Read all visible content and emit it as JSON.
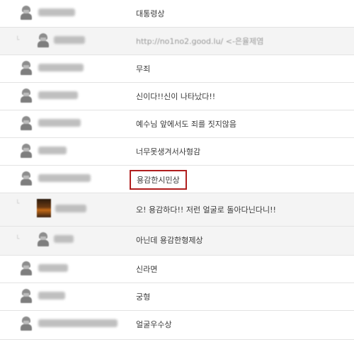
{
  "comments": [
    {
      "text": "대통령상"
    },
    {
      "text": "http://no1no2.good.lu/ <-은율제염"
    },
    {
      "text": "무죄"
    },
    {
      "text": "신이다!!신이 나타났다!!"
    },
    {
      "text": "예수님 앞에서도 죄를 짓지않음"
    },
    {
      "text": "너무못생겨서사형감"
    },
    {
      "text": "용감한시민상"
    },
    {
      "text": "오! 용감하다!! 저런 얼굴로 돌아다닌다니!!"
    },
    {
      "text": "아닌데 용감한형제상"
    },
    {
      "text": "신라면"
    },
    {
      "text": "궁형"
    },
    {
      "text": "얼굴우수상"
    }
  ],
  "colors": {
    "highlight_border": "#b01e1e",
    "alt_row": "#f4f4f4",
    "url_text": "#999999"
  },
  "icons": {
    "avatar": "user-avatar-icon",
    "reply": "reply-arrow-icon"
  }
}
